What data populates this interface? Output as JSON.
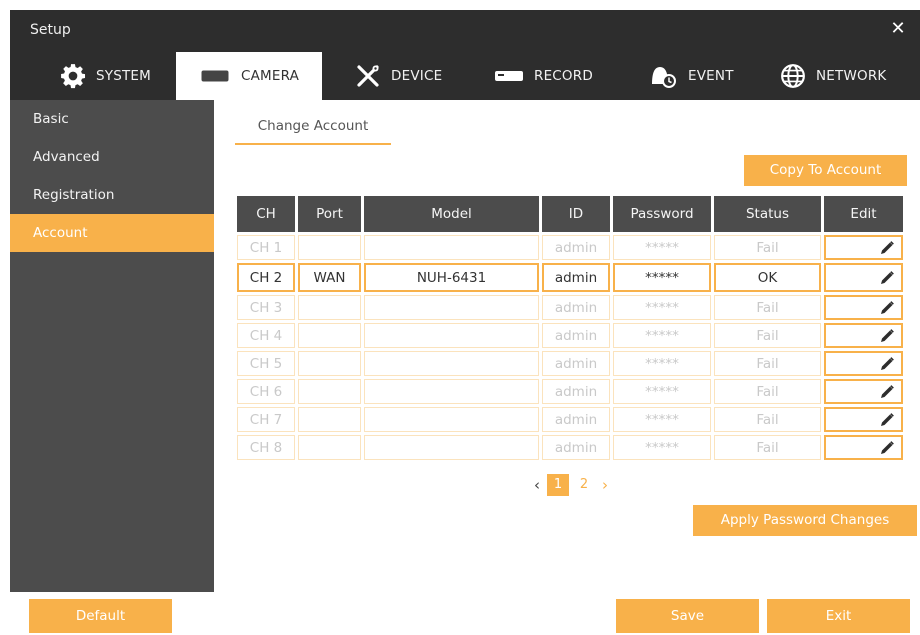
{
  "window": {
    "title": "Setup",
    "close_glyph": "✕"
  },
  "tabs": [
    {
      "label": "SYSTEM",
      "icon": "gear-icon"
    },
    {
      "label": "CAMERA",
      "icon": "camera-icon"
    },
    {
      "label": "DEVICE",
      "icon": "tools-icon"
    },
    {
      "label": "RECORD",
      "icon": "recorder-icon"
    },
    {
      "label": "EVENT",
      "icon": "alarm-icon"
    },
    {
      "label": "NETWORK",
      "icon": "globe-icon"
    }
  ],
  "active_tab": "CAMERA",
  "sidebar": {
    "items": [
      {
        "label": "Basic"
      },
      {
        "label": "Advanced"
      },
      {
        "label": "Registration"
      },
      {
        "label": "Account"
      }
    ],
    "active": "Account"
  },
  "subtab": {
    "label": "Change Account"
  },
  "buttons": {
    "copy_to_account": "Copy To Account",
    "apply_password_changes": "Apply Password Changes",
    "default": "Default",
    "save": "Save",
    "exit": "Exit"
  },
  "table": {
    "headers": [
      "CH",
      "Port",
      "Model",
      "ID",
      "Password",
      "Status",
      "Edit"
    ],
    "rows": [
      {
        "ch": "CH 1",
        "port": "",
        "model": "",
        "id": "admin",
        "password": "*****",
        "status": "Fail",
        "connected": false
      },
      {
        "ch": "CH 2",
        "port": "WAN",
        "model": "NUH-6431",
        "id": "admin",
        "password": "*****",
        "status": "OK",
        "connected": true
      },
      {
        "ch": "CH 3",
        "port": "",
        "model": "",
        "id": "admin",
        "password": "*****",
        "status": "Fail",
        "connected": false
      },
      {
        "ch": "CH 4",
        "port": "",
        "model": "",
        "id": "admin",
        "password": "*****",
        "status": "Fail",
        "connected": false
      },
      {
        "ch": "CH 5",
        "port": "",
        "model": "",
        "id": "admin",
        "password": "*****",
        "status": "Fail",
        "connected": false
      },
      {
        "ch": "CH 6",
        "port": "",
        "model": "",
        "id": "admin",
        "password": "*****",
        "status": "Fail",
        "connected": false
      },
      {
        "ch": "CH 7",
        "port": "",
        "model": "",
        "id": "admin",
        "password": "*****",
        "status": "Fail",
        "connected": false
      },
      {
        "ch": "CH 8",
        "port": "",
        "model": "",
        "id": "admin",
        "password": "*****",
        "status": "Fail",
        "connected": false
      }
    ],
    "edit_icon": "pencil-icon"
  },
  "pagination": {
    "prev": "‹",
    "pages": [
      "1",
      "2"
    ],
    "current": "1",
    "next": "›"
  },
  "colors": {
    "accent": "#f8b14a",
    "dark": "#2d2d2d",
    "sidebar": "#4c4c4c"
  }
}
